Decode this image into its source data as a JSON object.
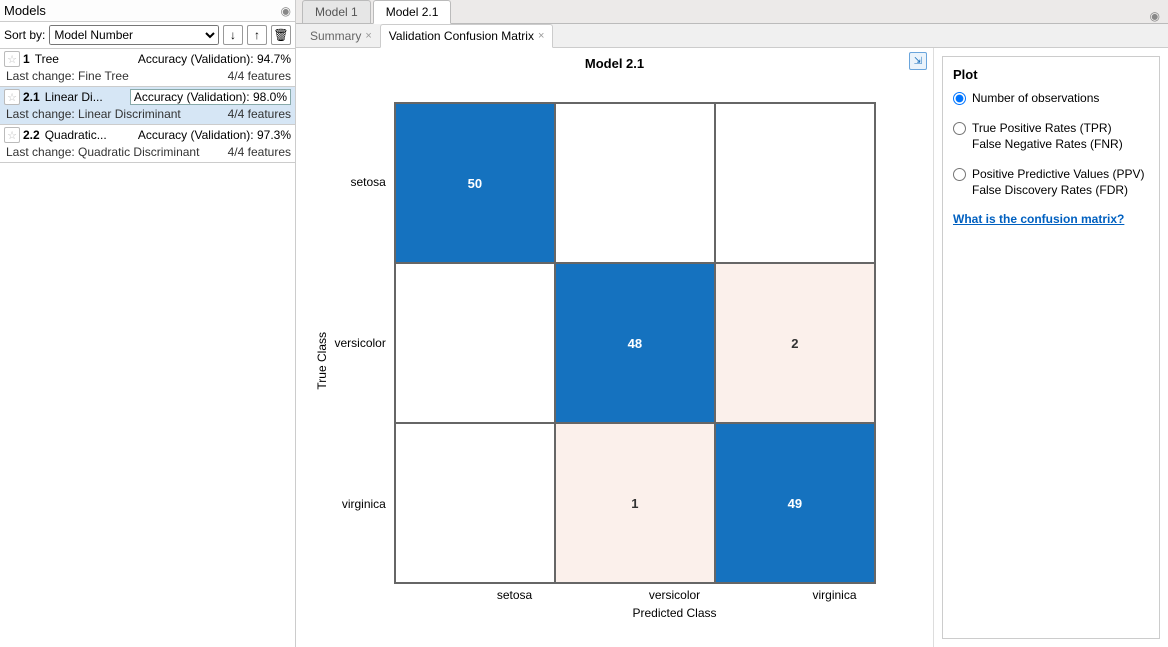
{
  "left": {
    "title": "Models",
    "sort_label": "Sort by:",
    "sort_options": [
      "Model Number"
    ],
    "sort_selected": "Model Number",
    "items": [
      {
        "num": "1",
        "name": "Tree",
        "acc_label": "Accuracy (Validation):",
        "acc_val": "94.7%",
        "sub_label": "Last change: Fine Tree",
        "features": "4/4 features",
        "selected": false
      },
      {
        "num": "2.1",
        "name": "Linear Di...",
        "acc_label": "Accuracy (Validation):",
        "acc_val": "98.0%",
        "sub_label": "Last change: Linear Discriminant",
        "features": "4/4 features",
        "selected": true
      },
      {
        "num": "2.2",
        "name": "Quadratic...",
        "acc_label": "Accuracy (Validation):",
        "acc_val": "97.3%",
        "sub_label": "Last change: Quadratic Discriminant",
        "features": "4/4 features",
        "selected": false
      }
    ]
  },
  "tabs": {
    "top": [
      {
        "label": "Model 1",
        "active": false
      },
      {
        "label": "Model 2.1",
        "active": true
      }
    ],
    "sub": [
      {
        "label": "Summary",
        "active": false
      },
      {
        "label": "Validation Confusion Matrix",
        "active": true
      }
    ]
  },
  "plot": {
    "title": "Model 2.1",
    "y_axis": "True Class",
    "x_axis": "Predicted Class",
    "classes": [
      "setosa",
      "versicolor",
      "virginica"
    ]
  },
  "chart_data": {
    "type": "heatmap",
    "title": "Model 2.1",
    "xlabel": "Predicted Class",
    "ylabel": "True Class",
    "categories": [
      "setosa",
      "versicolor",
      "virginica"
    ],
    "matrix": [
      [
        50,
        0,
        0
      ],
      [
        0,
        48,
        2
      ],
      [
        0,
        1,
        49
      ]
    ],
    "colors": {
      "high": "#1572bf",
      "low": "#fbf0eb",
      "zero": "#ffffff"
    }
  },
  "options": {
    "title": "Plot",
    "radios": [
      {
        "lines": [
          "Number of observations"
        ],
        "checked": true
      },
      {
        "lines": [
          "True Positive Rates (TPR)",
          "False Negative Rates (FNR)"
        ],
        "checked": false
      },
      {
        "lines": [
          "Positive Predictive Values (PPV)",
          "False Discovery Rates (FDR)"
        ],
        "checked": false
      }
    ],
    "help": "What is the confusion matrix?"
  }
}
